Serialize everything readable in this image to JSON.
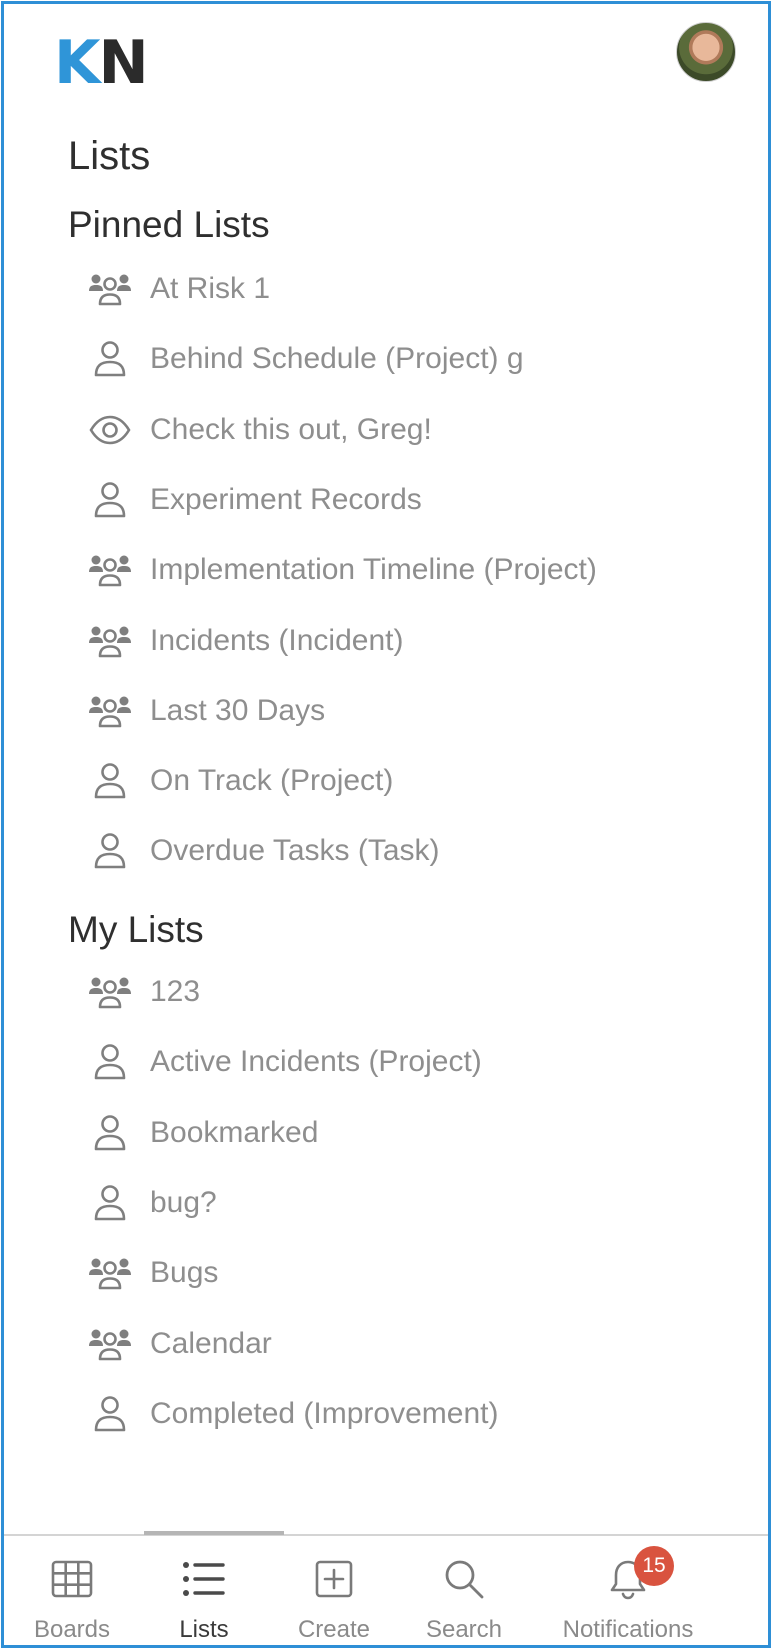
{
  "header": {
    "logo_k": "K",
    "logo_n": "N"
  },
  "page": {
    "title": "Lists"
  },
  "pinned": {
    "title": "Pinned Lists",
    "items": [
      {
        "label": "At Risk 1",
        "icon": "team-icon"
      },
      {
        "label": "Behind Schedule (Project) g",
        "icon": "person-icon"
      },
      {
        "label": "Check this out, Greg!",
        "icon": "eye-icon"
      },
      {
        "label": "Experiment Records",
        "icon": "person-icon"
      },
      {
        "label": "Implementation Timeline (Project)",
        "icon": "team-icon"
      },
      {
        "label": "Incidents (Incident)",
        "icon": "team-icon"
      },
      {
        "label": "Last 30 Days",
        "icon": "team-icon"
      },
      {
        "label": "On Track (Project)",
        "icon": "person-icon"
      },
      {
        "label": "Overdue Tasks (Task)",
        "icon": "person-icon"
      }
    ]
  },
  "mylists": {
    "title": "My Lists",
    "items": [
      {
        "label": "123",
        "icon": "team-icon"
      },
      {
        "label": "Active Incidents (Project)",
        "icon": "person-icon"
      },
      {
        "label": "Bookmarked",
        "icon": "person-icon"
      },
      {
        "label": "bug?",
        "icon": "person-icon"
      },
      {
        "label": "Bugs",
        "icon": "team-icon"
      },
      {
        "label": "Calendar",
        "icon": "team-icon"
      },
      {
        "label": "Completed (Improvement)",
        "icon": "person-icon"
      }
    ]
  },
  "nav": {
    "boards": "Boards",
    "lists": "Lists",
    "create": "Create",
    "search": "Search",
    "notifications": "Notifications",
    "notification_count": "15",
    "active": "lists"
  },
  "colors": {
    "accent": "#2f95d8",
    "border": "#2e8fd6",
    "badge": "#d9533f",
    "item_text": "#8e8e8e"
  }
}
